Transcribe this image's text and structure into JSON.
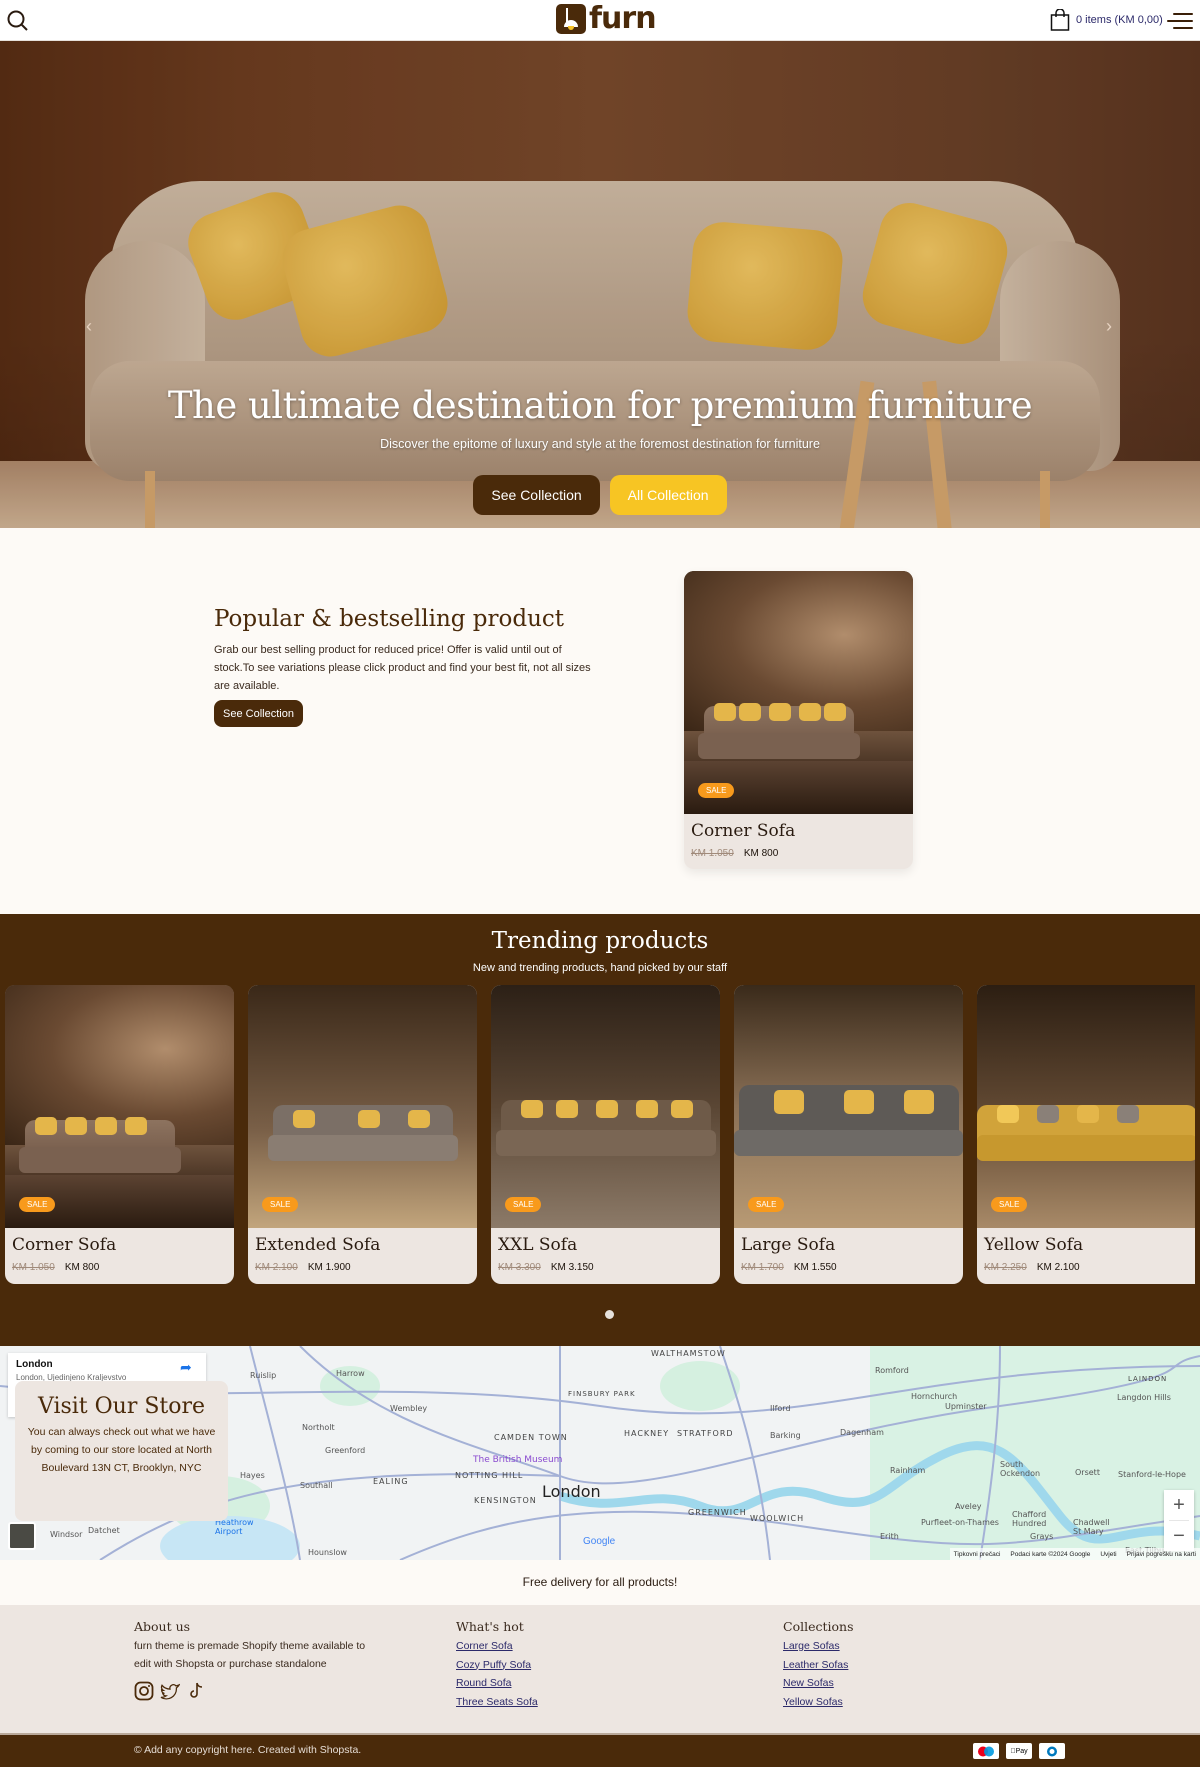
{
  "header": {
    "logo_text": "furn",
    "cart_label": "0 items (KM 0,00)",
    "icons": [
      "search-icon",
      "shopping-bag-icon",
      "menu-icon"
    ]
  },
  "hero": {
    "title": "The ultimate destination for premium furniture",
    "subtitle": "Discover the epitome of luxury and style at the foremost destination for furniture",
    "primary_button": "See Collection",
    "secondary_button": "All Collection",
    "prev_arrow": "‹",
    "next_arrow": "›",
    "slide_count": 1,
    "active_slide": 1,
    "colors": {
      "dark": "#4a2a0a",
      "accent": "#f7c523"
    }
  },
  "popular": {
    "title": "Popular & bestselling product",
    "description": "Grab our best selling product for reduced price! Offer is valid until out of stock.To see variations please click product and find your best fit, not all sizes are available.",
    "button": "See Collection",
    "product": {
      "name": "Corner Sofa",
      "badge": "SALE",
      "old_price": "KM 1.050",
      "price": "KM 800"
    }
  },
  "trending": {
    "title": "Trending products",
    "subtitle": "New and trending products, hand picked by our staff",
    "products": [
      {
        "name": "Corner Sofa",
        "badge": "SALE",
        "old_price": "KM 1.050",
        "price": "KM 800"
      },
      {
        "name": "Extended Sofa",
        "badge": "SALE",
        "old_price": "KM 2.100",
        "price": "KM 1.900"
      },
      {
        "name": "XXL Sofa",
        "badge": "SALE",
        "old_price": "KM 3.300",
        "price": "KM 3.150"
      },
      {
        "name": "Large Sofa",
        "badge": "SALE",
        "old_price": "KM 1.700",
        "price": "KM 1.550"
      },
      {
        "name": "Yellow Sofa",
        "badge": "SALE",
        "old_price": "KM 2.250",
        "price": "KM 2.100"
      }
    ]
  },
  "map": {
    "place_name": "London",
    "place_address": "London, Ujedinjeno Kraljevstvo",
    "visit_title": "Visit Our Store",
    "visit_text": "You can always check out what we have by coming to our store located at North Boulevard 13N CT, Brooklyn, NYC",
    "labels": {
      "london": "London",
      "museum": "The British Museum",
      "camden": "CAMDEN TOWN",
      "hackney": "HACKNEY",
      "stratford": "STRATFORD",
      "notting": "NOTTING HILL",
      "kensington": "KENSINGTON",
      "greenwich": "GREENWICH",
      "woolwich": "WOOLWICH",
      "ealing": "EALING",
      "walthamstow": "WALTHAMSTOW",
      "finsbury": "FINSBURY PARK",
      "harrow": "Harrow",
      "wembley": "Wembley",
      "northolt": "Northolt",
      "greenford": "Greenford",
      "southall": "Southall",
      "hayes": "Hayes",
      "hounslow": "Hounslow",
      "windsor": "Windsor",
      "datchet": "Datchet",
      "ruislip": "Ruislip",
      "ilford": "Ilford",
      "barking": "Barking",
      "dagenham": "Dagenham",
      "romford": "Romford",
      "hornchurch": "Hornchurch",
      "upminster": "Upminster",
      "rainham": "Rainham",
      "south_ockendon": "South Ockendon",
      "orsett": "Orsett",
      "stanford": "Stanford-le-Hope",
      "laindon": "LAINDON",
      "langdon": "Langdon Hills",
      "aveley": "Aveley",
      "purfleet": "Purfleet-on-Thames",
      "chafford": "Chafford Hundred",
      "grays": "Grays",
      "chadwell": "Chadwell St Mary",
      "erith": "Erith",
      "east_tilbury": "East Tilbury",
      "heathrow": "Heathrow Airport"
    },
    "zoom_in": "+",
    "zoom_out": "−",
    "google": "Google",
    "attribution": [
      "Tipkovni prečaci",
      "Podaci karte ©2024 Google",
      "Uvjeti",
      "Prijavi pogrešku na karti"
    ]
  },
  "delivery": {
    "text": "Free delivery for all products!"
  },
  "footer": {
    "about": {
      "title": "About us",
      "text": "furn theme is premade Shopify theme available to edit with Shopsta or purchase standalone"
    },
    "hot": {
      "title": "What's hot",
      "links": [
        "Corner Sofa",
        "Cozy Puffy Sofa",
        "Round Sofa",
        "Three Seats Sofa"
      ]
    },
    "collections": {
      "title": "Collections",
      "links": [
        "Large Sofas",
        "Leather Sofas",
        "New Sofas",
        "Yellow Sofas"
      ]
    },
    "social": [
      "instagram-icon",
      "twitter-icon",
      "tiktok-icon"
    ],
    "copyright": "© Add any copyright here. Created with Shopsta.",
    "payments": [
      "Maestro",
      "Apple Pay",
      "Diners Club"
    ]
  }
}
